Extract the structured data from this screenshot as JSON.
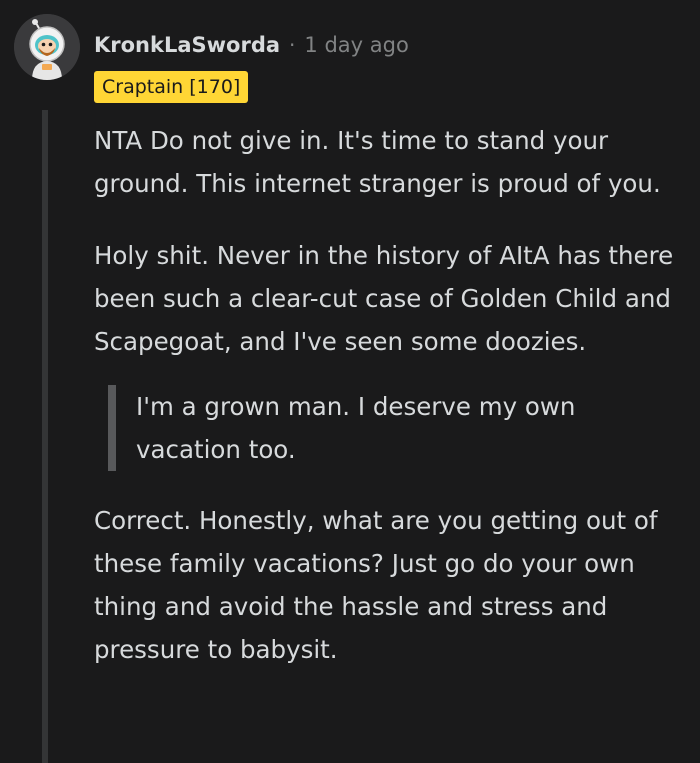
{
  "comment": {
    "username": "KronkLaSworda",
    "separator": "·",
    "timestamp": "1 day ago",
    "flair": "Craptain [170]",
    "avatar_icon": "astronaut-snoo-avatar",
    "paragraphs": [
      "NTA Do not give in. It's time to stand your ground. This internet stranger is proud of you.",
      "Holy shit. Never in the history of AItA has there been such a clear-cut case of Golden Child and Scapegoat, and I've seen some doozies."
    ],
    "quote": "I'm a grown man. I deserve my own vacation too.",
    "closing_paragraph": "Correct. Honestly, what are you getting out of these family vacations? Just go do your own thing and avoid the hassle and stress and pressure to babysit."
  },
  "colors": {
    "background": "#1a1a1b",
    "text": "#d7dadc",
    "meta": "#818384",
    "flair_bg": "#ffd635",
    "thread_line": "#343536",
    "quote_bar": "#58595b"
  }
}
